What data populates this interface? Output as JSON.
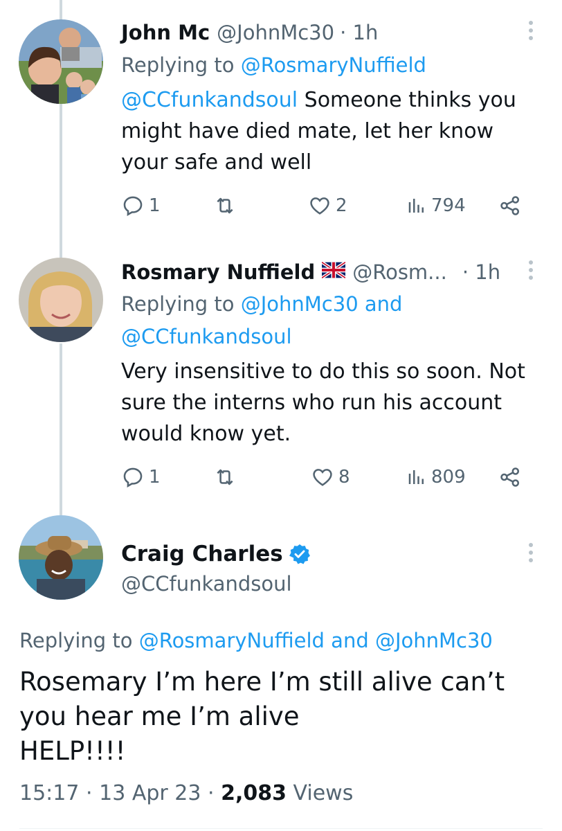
{
  "tweets": [
    {
      "name": "John Mc",
      "handle": "@JohnMc30",
      "time": "· 1h",
      "replying_prefix": "Replying to",
      "replying_to": "@RosmaryNuffield",
      "replying_to_2": "",
      "mention": "@CCfunkandsoul",
      "text_line1": "Someone thinks you",
      "text_line2": "might have died mate, let her know",
      "text_line3": "your safe and well",
      "replies": "1",
      "likes": "2",
      "views": "794"
    },
    {
      "name": "Rosmary Nuffield",
      "handle": "@Rosm...",
      "time": "· 1h",
      "flag_icon": "uk-flag-icon",
      "replying_prefix": "Replying to",
      "replying_to": "@JohnMc30",
      "replying_joiner": "and",
      "replying_to_2": "@CCfunkandsoul",
      "text_line1": "Very insensitive to do this so soon. Not",
      "text_line2": "sure the interns who run his account",
      "text_line3": "would know yet.",
      "replies": "1",
      "likes": "8",
      "views": "809"
    }
  ],
  "main_tweet": {
    "name": "Craig Charles",
    "handle": "@CCfunkandsoul",
    "verified_icon": "verified-badge-icon",
    "replying_prefix": "Replying to",
    "replying_to": "@RosmaryNuffield",
    "replying_joiner": "and",
    "replying_to_2": "@JohnMc30",
    "text_line1": "Rosemary I’m here I’m still alive can’t",
    "text_line2": "you hear me I’m alive",
    "text_line3": "HELP!!!!",
    "time": "15:17",
    "sep1": "·",
    "date": "13 Apr 23",
    "sep2": "·",
    "views_count": "2,083",
    "views_label": "Views"
  },
  "colors": {
    "accent": "#1d9bf0",
    "secondary_text": "#536471",
    "primary_text": "#0f1419",
    "thread_line": "#cfd9de"
  }
}
